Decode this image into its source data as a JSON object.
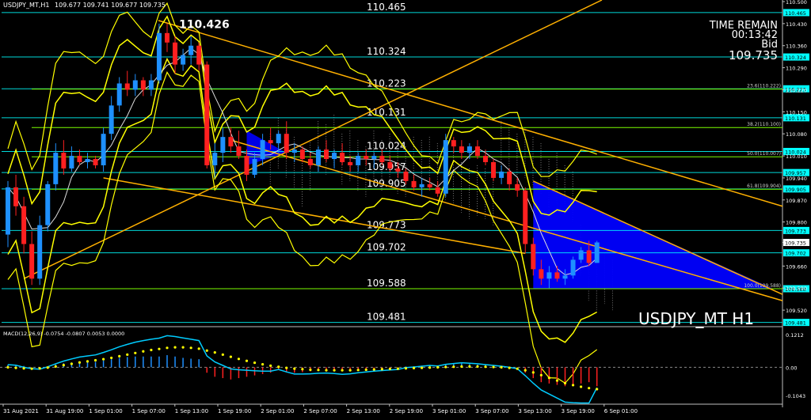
{
  "header": {
    "title": "USDJPY_MT,H1",
    "ohlc": "109.677 109.741 109.677 109.735"
  },
  "info": {
    "time_label": "TIME REMAIN",
    "time_value": "00:13:42",
    "bid_label": "Bid",
    "bid_value": "109.735"
  },
  "watermark": "USDJPY_MT H1",
  "colors": {
    "background": "#000000",
    "bull": "#1E90FF",
    "bear": "#FF2020",
    "level_line": "#00FFFF",
    "band": "#FFFF00",
    "trend": "#FFB000",
    "fib": "#7CFC00",
    "fill": "#0000FF",
    "macd_signal": "#FFFF00",
    "macd_line": "#00CCFF"
  },
  "chart_data": [
    {
      "type": "candlestick",
      "title": "USDJPY_MT,H1",
      "ylim": [
        109.47,
        110.5
      ],
      "y_ticks": [
        "110.500",
        "110.430",
        "110.360",
        "110.290",
        "110.220",
        "110.150",
        "110.080",
        "110.010",
        "109.940",
        "109.870",
        "109.800",
        "109.735",
        "109.660",
        "109.590",
        "109.520"
      ],
      "levels": [
        {
          "label": "110.465",
          "value": 110.465
        },
        {
          "label": "110.324",
          "value": 110.324
        },
        {
          "label": "110.223",
          "value": 110.223
        },
        {
          "label": "110.131",
          "value": 110.131
        },
        {
          "label": "110.024",
          "value": 110.024
        },
        {
          "label": "109.957",
          "value": 109.957
        },
        {
          "label": "109.905",
          "value": 109.905
        },
        {
          "label": "109.773",
          "value": 109.773
        },
        {
          "label": "109.702",
          "value": 109.702
        },
        {
          "label": "109.588",
          "value": 109.588
        },
        {
          "label": "109.481",
          "value": 109.481
        }
      ],
      "mid_labels": [
        "110.465",
        "110.324",
        "110.223",
        "110.131",
        "110.024",
        "109.957",
        "109.905",
        "109.773",
        "109.702",
        "109.588",
        "109.481"
      ],
      "high_label": "110.426",
      "fib_levels": [
        {
          "label": "23.6(110.222)",
          "value": 110.222
        },
        {
          "label": "38.2(110.100)",
          "value": 110.1
        },
        {
          "label": "50.0(110.007)",
          "value": 110.007
        },
        {
          "label": "61.8(109.904)",
          "value": 109.904
        },
        {
          "label": "100.0(109.588)",
          "value": 109.588
        }
      ],
      "candles": [
        [
          109.76,
          109.93,
          109.72,
          109.91
        ],
        [
          109.91,
          109.95,
          109.82,
          109.85
        ],
        [
          109.85,
          109.88,
          109.7,
          109.73
        ],
        [
          109.73,
          109.77,
          109.6,
          109.62
        ],
        [
          109.62,
          109.82,
          109.6,
          109.79
        ],
        [
          109.79,
          109.93,
          109.77,
          109.92
        ],
        [
          109.92,
          110.05,
          109.9,
          110.02
        ],
        [
          110.02,
          110.06,
          109.95,
          109.97
        ],
        [
          109.97,
          110.04,
          109.96,
          110.01
        ],
        [
          110.01,
          110.03,
          109.98,
          109.99
        ],
        [
          109.99,
          110.02,
          109.97,
          110.0
        ],
        [
          110.0,
          110.01,
          109.97,
          109.98
        ],
        [
          109.98,
          110.1,
          109.96,
          110.08
        ],
        [
          110.08,
          110.2,
          110.06,
          110.17
        ],
        [
          110.17,
          110.26,
          110.15,
          110.24
        ],
        [
          110.24,
          110.28,
          110.2,
          110.22
        ],
        [
          110.22,
          110.27,
          110.2,
          110.25
        ],
        [
          110.25,
          110.26,
          110.2,
          110.22
        ],
        [
          110.22,
          110.27,
          110.2,
          110.25
        ],
        [
          110.25,
          110.43,
          110.24,
          110.4
        ],
        [
          110.4,
          110.43,
          110.34,
          110.37
        ],
        [
          110.37,
          110.39,
          110.27,
          110.3
        ],
        [
          110.3,
          110.35,
          110.28,
          110.33
        ],
        [
          110.33,
          110.39,
          110.3,
          110.36
        ],
        [
          110.36,
          110.37,
          110.28,
          110.3
        ],
        [
          110.3,
          110.31,
          109.97,
          109.98
        ],
        [
          109.98,
          110.05,
          109.94,
          110.02
        ],
        [
          110.02,
          110.1,
          109.99,
          110.07
        ],
        [
          110.07,
          110.1,
          110.02,
          110.04
        ],
        [
          110.04,
          110.09,
          110.0,
          110.01
        ],
        [
          110.01,
          110.03,
          109.93,
          109.95
        ],
        [
          109.95,
          110.02,
          109.94,
          110.0
        ],
        [
          110.0,
          110.08,
          109.98,
          110.06
        ],
        [
          110.06,
          110.1,
          110.03,
          110.05
        ],
        [
          110.05,
          110.09,
          110.02,
          110.08
        ],
        [
          110.08,
          110.12,
          110.0,
          110.02
        ],
        [
          110.02,
          110.05,
          109.99,
          110.03
        ],
        [
          110.03,
          110.04,
          109.99,
          110.0
        ],
        [
          110.0,
          110.02,
          109.97,
          109.98
        ],
        [
          109.98,
          110.04,
          109.96,
          110.03
        ],
        [
          110.03,
          110.06,
          109.99,
          110.0
        ],
        [
          110.0,
          110.03,
          109.97,
          110.02
        ],
        [
          110.02,
          110.05,
          109.98,
          109.99
        ],
        [
          109.99,
          110.01,
          109.96,
          109.98
        ],
        [
          109.98,
          110.02,
          109.96,
          110.01
        ],
        [
          110.01,
          110.03,
          109.98,
          110.0
        ],
        [
          110.0,
          110.02,
          109.97,
          110.01
        ],
        [
          110.01,
          110.03,
          109.98,
          109.99
        ],
        [
          109.99,
          110.01,
          109.96,
          109.97
        ],
        [
          109.97,
          109.99,
          109.94,
          109.96
        ],
        [
          109.96,
          109.97,
          109.92,
          109.93
        ],
        [
          109.93,
          109.95,
          109.9,
          109.91
        ],
        [
          109.91,
          109.94,
          109.88,
          109.92
        ],
        [
          109.92,
          109.94,
          109.9,
          109.91
        ],
        [
          109.91,
          109.93,
          109.88,
          109.89
        ],
        [
          109.89,
          110.08,
          109.88,
          110.06
        ],
        [
          110.06,
          110.07,
          110.02,
          110.04
        ],
        [
          110.04,
          110.06,
          110.0,
          110.02
        ],
        [
          110.02,
          110.05,
          110.0,
          110.04
        ],
        [
          110.04,
          110.06,
          110.0,
          110.01
        ],
        [
          110.01,
          110.03,
          109.98,
          109.99
        ],
        [
          109.99,
          110.0,
          109.93,
          109.94
        ],
        [
          109.94,
          109.98,
          109.92,
          109.96
        ],
        [
          109.96,
          109.97,
          109.9,
          109.92
        ],
        [
          109.92,
          109.94,
          109.88,
          109.9
        ],
        [
          109.9,
          109.91,
          109.7,
          109.73
        ],
        [
          109.73,
          109.75,
          109.63,
          109.65
        ],
        [
          109.65,
          109.68,
          109.6,
          109.62
        ],
        [
          109.62,
          109.66,
          109.59,
          109.64
        ],
        [
          109.64,
          109.66,
          109.61,
          109.62
        ],
        [
          109.62,
          109.65,
          109.6,
          109.63
        ],
        [
          109.63,
          109.69,
          109.62,
          109.68
        ],
        [
          109.68,
          109.72,
          109.67,
          109.71
        ],
        [
          109.71,
          109.74,
          109.66,
          109.67
        ],
        [
          109.67,
          109.74,
          109.67,
          109.735
        ]
      ],
      "x_labels": [
        "31 Aug 2021",
        "31 Aug 19:00",
        "1 Sep 01:00",
        "1 Sep 07:00",
        "1 Sep 13:00",
        "1 Sep 19:00",
        "2 Sep 01:00",
        "2 Sep 07:00",
        "2 Sep 13:00",
        "2 Sep 19:00",
        "3 Sep 01:00",
        "3 Sep 07:00",
        "3 Sep 13:00",
        "3 Sep 19:00",
        "6 Sep 01:00"
      ]
    },
    {
      "type": "bar",
      "title": "MACD(12,26,9) -0.0754 -0.0807 0.0053 0.0000",
      "ylim": [
        -0.1043,
        0.1212
      ],
      "y_ticks": [
        "0.1212",
        "0.00",
        "-0.1043"
      ],
      "histogram": [
        0.01,
        0.01,
        0.005,
        0.0,
        -0.003,
        0.003,
        0.01,
        0.015,
        0.018,
        0.02,
        0.02,
        0.02,
        0.025,
        0.03,
        0.035,
        0.038,
        0.04,
        0.04,
        0.04,
        0.04,
        0.045,
        0.04,
        0.035,
        0.032,
        0.03,
        -0.02,
        -0.035,
        -0.04,
        -0.045,
        -0.04,
        -0.035,
        -0.03,
        -0.025,
        -0.02,
        -0.01,
        -0.015,
        -0.02,
        -0.018,
        -0.015,
        -0.012,
        -0.01,
        -0.012,
        -0.015,
        -0.013,
        -0.01,
        -0.008,
        -0.006,
        -0.005,
        -0.004,
        -0.003,
        0.003,
        0.004,
        0.006,
        0.008,
        0.005,
        0.01,
        0.012,
        0.014,
        0.012,
        0.01,
        0.008,
        0.006,
        0.004,
        0.002,
        0.0,
        -0.02,
        -0.04,
        -0.055,
        -0.06,
        -0.065,
        -0.07,
        -0.065,
        -0.06,
        -0.055,
        -0.07
      ],
      "signal": [
        0.0,
        -0.002,
        -0.004,
        -0.005,
        -0.004,
        -0.001,
        0.003,
        0.008,
        0.013,
        0.018,
        0.022,
        0.026,
        0.03,
        0.035,
        0.041,
        0.047,
        0.053,
        0.059,
        0.064,
        0.068,
        0.072,
        0.074,
        0.074,
        0.072,
        0.069,
        0.062,
        0.055,
        0.047,
        0.039,
        0.031,
        0.024,
        0.017,
        0.011,
        0.006,
        0.002,
        -0.002,
        -0.005,
        -0.007,
        -0.009,
        -0.01,
        -0.011,
        -0.011,
        -0.011,
        -0.011,
        -0.01,
        -0.009,
        -0.008,
        -0.007,
        -0.006,
        -0.005,
        -0.004,
        -0.003,
        -0.002,
        -0.001,
        0.0,
        0.001,
        0.002,
        0.003,
        0.003,
        0.003,
        0.002,
        0.001,
        0.0,
        -0.002,
        -0.005,
        -0.011,
        -0.019,
        -0.029,
        -0.039,
        -0.049,
        -0.059,
        -0.066,
        -0.072,
        -0.077,
        -0.0807
      ],
      "macd": [
        0.01,
        0.008,
        0.0,
        -0.005,
        -0.007,
        0.002,
        0.013,
        0.023,
        0.031,
        0.038,
        0.042,
        0.046,
        0.055,
        0.065,
        0.076,
        0.085,
        0.093,
        0.099,
        0.104,
        0.108,
        0.117,
        0.114,
        0.109,
        0.104,
        0.099,
        0.042,
        0.02,
        0.007,
        -0.006,
        -0.009,
        -0.011,
        -0.013,
        -0.014,
        -0.014,
        -0.008,
        -0.017,
        -0.025,
        -0.025,
        -0.024,
        -0.022,
        -0.021,
        -0.023,
        -0.026,
        -0.024,
        -0.02,
        -0.017,
        -0.014,
        -0.012,
        -0.01,
        -0.008,
        -0.001,
        0.001,
        0.004,
        0.007,
        0.005,
        0.011,
        0.014,
        0.017,
        0.015,
        0.013,
        0.01,
        0.007,
        0.004,
        0.0,
        -0.005,
        -0.031,
        -0.059,
        -0.084,
        -0.099,
        -0.114,
        -0.129,
        -0.131,
        -0.132,
        -0.132,
        -0.0754
      ]
    }
  ]
}
